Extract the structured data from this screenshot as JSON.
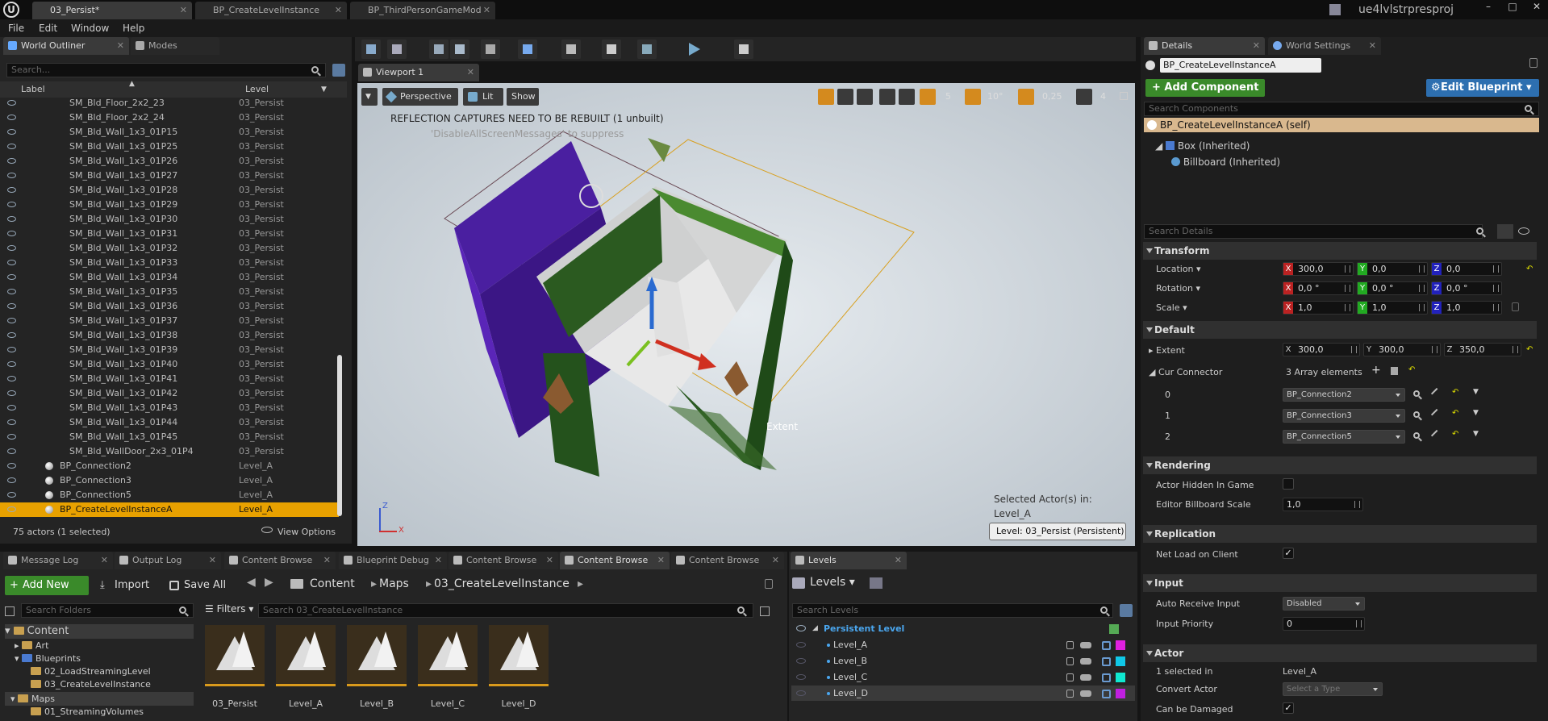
{
  "app": {
    "logo": "U",
    "project_name": "ue4lvlstrpresproj"
  },
  "doc_tabs": [
    "03_Persist*",
    "BP_CreateLevelInstance",
    "BP_ThirdPersonGameMod"
  ],
  "menu": [
    "File",
    "Edit",
    "Window",
    "Help"
  ],
  "outliner": {
    "tabs": [
      "World Outliner",
      "Modes"
    ],
    "search_placeholder": "Search...",
    "col_label": "Label",
    "col_level": "Level",
    "rows": [
      {
        "name": "SM_Bld_Floor_2x2_23",
        "level": "03_Persist"
      },
      {
        "name": "SM_Bld_Floor_2x2_24",
        "level": "03_Persist"
      },
      {
        "name": "SM_Bld_Wall_1x3_01P15",
        "level": "03_Persist"
      },
      {
        "name": "SM_Bld_Wall_1x3_01P25",
        "level": "03_Persist"
      },
      {
        "name": "SM_Bld_Wall_1x3_01P26",
        "level": "03_Persist"
      },
      {
        "name": "SM_Bld_Wall_1x3_01P27",
        "level": "03_Persist"
      },
      {
        "name": "SM_Bld_Wall_1x3_01P28",
        "level": "03_Persist"
      },
      {
        "name": "SM_Bld_Wall_1x3_01P29",
        "level": "03_Persist"
      },
      {
        "name": "SM_Bld_Wall_1x3_01P30",
        "level": "03_Persist"
      },
      {
        "name": "SM_Bld_Wall_1x3_01P31",
        "level": "03_Persist"
      },
      {
        "name": "SM_Bld_Wall_1x3_01P32",
        "level": "03_Persist"
      },
      {
        "name": "SM_Bld_Wall_1x3_01P33",
        "level": "03_Persist"
      },
      {
        "name": "SM_Bld_Wall_1x3_01P34",
        "level": "03_Persist"
      },
      {
        "name": "SM_Bld_Wall_1x3_01P35",
        "level": "03_Persist"
      },
      {
        "name": "SM_Bld_Wall_1x3_01P36",
        "level": "03_Persist"
      },
      {
        "name": "SM_Bld_Wall_1x3_01P37",
        "level": "03_Persist"
      },
      {
        "name": "SM_Bld_Wall_1x3_01P38",
        "level": "03_Persist"
      },
      {
        "name": "SM_Bld_Wall_1x3_01P39",
        "level": "03_Persist"
      },
      {
        "name": "SM_Bld_Wall_1x3_01P40",
        "level": "03_Persist"
      },
      {
        "name": "SM_Bld_Wall_1x3_01P41",
        "level": "03_Persist"
      },
      {
        "name": "SM_Bld_Wall_1x3_01P42",
        "level": "03_Persist"
      },
      {
        "name": "SM_Bld_Wall_1x3_01P43",
        "level": "03_Persist"
      },
      {
        "name": "SM_Bld_Wall_1x3_01P44",
        "level": "03_Persist"
      },
      {
        "name": "SM_Bld_Wall_1x3_01P45",
        "level": "03_Persist"
      },
      {
        "name": "SM_Bld_WallDoor_2x3_01P4",
        "level": "03_Persist"
      }
    ],
    "bp_rows": [
      {
        "name": "BP_Connection2",
        "level": "Level_A"
      },
      {
        "name": "BP_Connection3",
        "level": "Level_A"
      },
      {
        "name": "BP_Connection5",
        "level": "Level_A"
      },
      {
        "name": "BP_CreateLevelInstanceA",
        "level": "Level_A"
      }
    ],
    "status": "75 actors (1 selected)",
    "view_options": "View Options"
  },
  "viewport": {
    "tab": "Viewport 1",
    "perspective": "Perspective",
    "lit": "Lit",
    "show": "Show",
    "grid": "5",
    "angle": "10°",
    "scale": "0,25",
    "speed": "4",
    "msg1": "REFLECTION CAPTURES NEED TO BE REBUILT (1 unbuilt)",
    "msg2": "'DisableAllScreenMessages' to suppress",
    "extent_label": "Extent",
    "selected1": "Selected Actor(s) in:",
    "selected2": "Level_A",
    "level_badge": "Level:  03_Persist (Persistent)",
    "axis_x": "X",
    "axis_z": "Z"
  },
  "bottom_tabs": [
    "Message Log",
    "Output Log",
    "Content Browse",
    "Blueprint Debug",
    "Content Browse",
    "Content Browse",
    "Content Browse"
  ],
  "content": {
    "add_new": "Add New",
    "import": "Import",
    "save_all": "Save All",
    "path": [
      "Content",
      "Maps",
      "03_CreateLevelInstance"
    ],
    "search_folders": "Search Folders",
    "filters": "Filters",
    "search_assets": "Search 03_CreateLevelInstance",
    "tree": {
      "content": "Content",
      "art": "Art",
      "blueprints": "Blueprints",
      "load": "02_LoadStreamingLevel",
      "create": "03_CreateLevelInstance",
      "maps": "Maps",
      "vol": "01_StreamingVolumes"
    },
    "assets": [
      "03_Persist",
      "Level_A",
      "Level_B",
      "Level_C",
      "Level_D"
    ]
  },
  "levels": {
    "tab": "Levels",
    "dropdown": "Levels",
    "search": "Search Levels",
    "persistent": "Persistent Level",
    "items": [
      {
        "name": "Level_A",
        "color": "#e020e0"
      },
      {
        "name": "Level_B",
        "color": "#10c8e8"
      },
      {
        "name": "Level_C",
        "color": "#10e8d0"
      },
      {
        "name": "Level_D",
        "color": "#c020e0"
      }
    ]
  },
  "details": {
    "tabs": [
      "Details",
      "World Settings"
    ],
    "actor_name": "BP_CreateLevelInstanceA",
    "add_component": "+ Add Component",
    "edit_blueprint": "Edit Blueprint",
    "search_components": "Search Components",
    "self": "BP_CreateLevelInstanceA (self)",
    "box": "Box (Inherited)",
    "billboard": "Billboard (Inherited)",
    "search_details": "Search Details",
    "transform": "Transform",
    "location": "Location",
    "rotation": "Rotation",
    "scale": "Scale",
    "loc": [
      "300,0",
      "0,0",
      "0,0"
    ],
    "rot": [
      "0,0 °",
      "0,0 °",
      "0,0 °"
    ],
    "scl": [
      "1,0",
      "1,0",
      "1,0"
    ],
    "default": "Default",
    "extent": "Extent",
    "ext": [
      "300,0",
      "300,0",
      "350,0"
    ],
    "cur_connector": "Cur Connector",
    "array_elements": "3 Array elements",
    "connectors": [
      {
        "i": "0",
        "v": "BP_Connection2"
      },
      {
        "i": "1",
        "v": "BP_Connection3"
      },
      {
        "i": "2",
        "v": "BP_Connection5"
      }
    ],
    "rendering": "Rendering",
    "hidden": "Actor Hidden In Game",
    "billboard_scale": "Editor Billboard Scale",
    "billboard_scale_v": "1,0",
    "replication": "Replication",
    "net_load": "Net Load on Client",
    "input": "Input",
    "auto_receive": "Auto Receive Input",
    "auto_receive_v": "Disabled",
    "input_priority": "Input Priority",
    "input_priority_v": "0",
    "actor": "Actor",
    "selected_in": "1 selected in",
    "selected_in_v": "Level_A",
    "convert_actor": "Convert Actor",
    "select_type": "Select a Type",
    "can_damaged": "Can be Damaged",
    "check": "✓"
  }
}
